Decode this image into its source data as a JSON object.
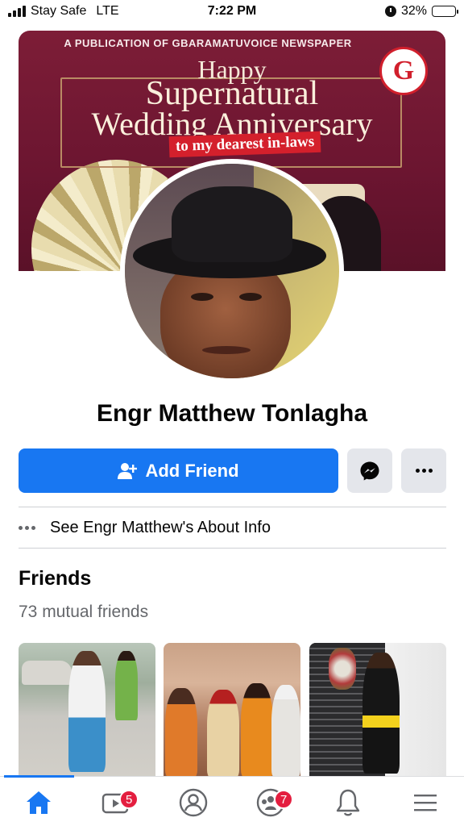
{
  "status_bar": {
    "carrier": "Stay Safe",
    "network": "LTE",
    "time": "7:22 PM",
    "battery_percent": "32%",
    "battery_level": 0.32
  },
  "cover": {
    "publication_line": "A PUBLICATION OF GBARAMATUVOICE NEWSPAPER",
    "headline_1": "Happy",
    "headline_2": "Supernatural",
    "headline_3": "Wedding Anniversary",
    "headline_4": "to my dearest in-laws",
    "logo_letter": "G"
  },
  "profile": {
    "name": "Engr Matthew Tonlagha"
  },
  "actions": {
    "add_friend_label": "Add Friend",
    "accent_color": "#1877f2"
  },
  "about": {
    "label": "See Engr Matthew's About Info"
  },
  "friends": {
    "title": "Friends",
    "mutual_count_text": "73 mutual friends"
  },
  "bottom_nav": {
    "items": [
      {
        "icon": "home-icon",
        "active": true
      },
      {
        "icon": "watch-video-icon",
        "badge": "5"
      },
      {
        "icon": "profile-icon"
      },
      {
        "icon": "groups-icon",
        "badge": "7"
      },
      {
        "icon": "notifications-bell-icon"
      },
      {
        "icon": "menu-icon"
      }
    ]
  }
}
